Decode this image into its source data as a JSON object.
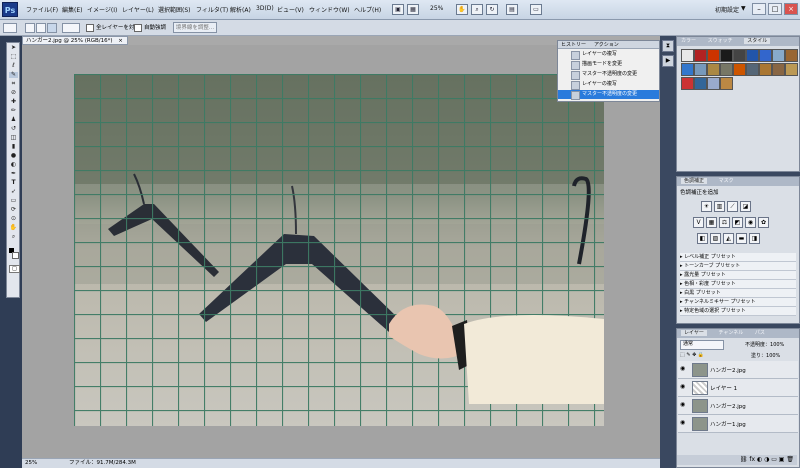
{
  "menubar": {
    "logo": "Ps",
    "items": [
      "ファイル(F)",
      "編集(E)",
      "イメージ(I)",
      "レイヤー(L)",
      "選択範囲(S)",
      "フィルタ(T)",
      "解析(A)",
      "3D(D)",
      "ビュー(V)",
      "ウィンドウ(W)",
      "ヘルプ(H)"
    ],
    "zoom": "25%",
    "workspace": "初期設定",
    "workspace_arrow": "▼",
    "win_min": "–",
    "win_max": "□",
    "win_close": "×"
  },
  "options": {
    "sample_all_layers": "全レイヤーを対象",
    "auto_enhance": "自動強調",
    "refine_edge": "境界線を調整..."
  },
  "document": {
    "tab_title": "ハンガー2.jpg @ 25% (RGB/16*)",
    "tab_close": "×",
    "status_zoom": "25%",
    "status_file": "ファイル：91.7M/284.3M"
  },
  "history": {
    "tab1": "ヒストリー",
    "tab2": "アクション",
    "items": [
      {
        "label": "レイヤーの複写",
        "selected": false
      },
      {
        "label": "描画モードを変更",
        "selected": false
      },
      {
        "label": "マスター不透明度の変更",
        "selected": false
      },
      {
        "label": "レイヤーの複写",
        "selected": false
      },
      {
        "label": "マスター不透明度の変更",
        "selected": true
      }
    ]
  },
  "swatches_panel": {
    "tabs": [
      "カラー",
      "スウォッチ",
      "スタイル"
    ],
    "colors": [
      "#e8e8e8",
      "#b22222",
      "#cc3300",
      "#1a1a1a",
      "#444444",
      "#2255aa",
      "#3366cc",
      "#88aacc",
      "#996633",
      "#3377cc",
      "#7799bb",
      "#aa8844",
      "#777766",
      "#cc5500",
      "#556677",
      "#aa7733",
      "#886644",
      "#bb9955",
      "#cc3333",
      "#336699",
      "#99aacc",
      "#bb8844"
    ]
  },
  "adjust_panel": {
    "tabs": [
      "色調補正",
      "マスク"
    ],
    "title": "色調補正を追加",
    "presets": [
      "レベル補正 プリセット",
      "トーンカーブ プリセット",
      "露光量 プリセット",
      "色相・彩度 プリセット",
      "白黒 プリセット",
      "チャンネルミキサー プリセット",
      "特定色域の選択 プリセット"
    ]
  },
  "layers_panel": {
    "tabs": [
      "レイヤー",
      "チャンネル",
      "パス"
    ],
    "blend_mode": "通常",
    "opacity_label": "不透明度：",
    "opacity": "100%",
    "fill_label": "塗り：",
    "fill": "100%",
    "layers": [
      "ハンガー2.jpg",
      "レイヤー 1",
      "ハンガー2.jpg",
      "ハンガー1.jpg"
    ]
  }
}
